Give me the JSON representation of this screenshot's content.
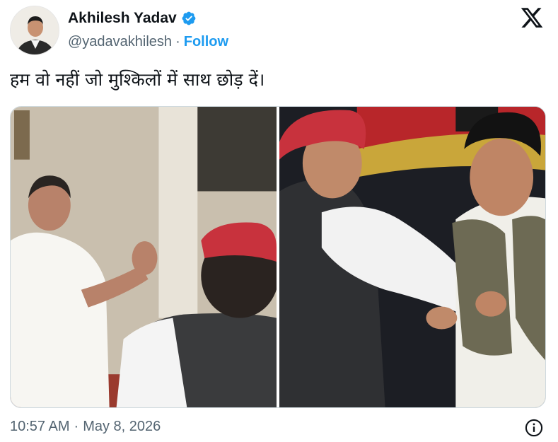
{
  "header": {
    "display_name": "Akhilesh Yadav",
    "handle": "@yadavakhilesh",
    "separator": "·",
    "follow_label": "Follow",
    "verified_icon": "verified-badge-icon",
    "brand_icon": "x-logo-icon",
    "accent_color": "#1d9bf0"
  },
  "tweet": {
    "text": "हम वो नहीं जो मुश्किलों में साथ छोड़ दें।"
  },
  "media": {
    "photo_count": 2
  },
  "footer": {
    "time": "10:57 AM",
    "separator": "·",
    "date": "May 8, 2026",
    "info_icon": "info-icon"
  }
}
